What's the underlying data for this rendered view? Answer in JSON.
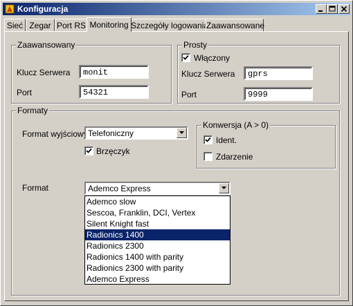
{
  "window": {
    "title": "Konfiguracja"
  },
  "tabs": [
    {
      "label": "Sieć"
    },
    {
      "label": "Zegar"
    },
    {
      "label": "Port RS"
    },
    {
      "label": "Monitoring"
    },
    {
      "label": "Szczegóły logowania"
    },
    {
      "label": "Zaawansowane"
    }
  ],
  "active_tab": "Monitoring",
  "advanced": {
    "title": "Zaawansowany",
    "server_key_label": "Klucz Serwera",
    "server_key_value": "monit",
    "port_label": "Port",
    "port_value": "54321"
  },
  "simple": {
    "title": "Prosty",
    "enabled_label": "Włączony",
    "enabled_checked": true,
    "server_key_label": "Klucz Serwera",
    "server_key_value": "gprs",
    "port_label": "Port",
    "port_value": "9999"
  },
  "formats": {
    "title": "Formaty",
    "output_format_label": "Format wyjściowy",
    "output_format_value": "Telefoniczny",
    "buzzer_label": "Brzęczyk",
    "buzzer_checked": true,
    "conversion": {
      "title": "Konwersja (A > 0)",
      "ident_label": "Ident.",
      "ident_checked": true,
      "event_label": "Zdarzenie",
      "event_checked": false
    },
    "format_label": "Format",
    "format_value": "Ademco Express",
    "format_options": [
      "Ademco slow",
      "Sescoa, Franklin, DCI, Vertex",
      "Silent Knight fast",
      "Radionics 1400",
      "Radionics 2300",
      "Radionics 1400 with parity",
      "Radionics 2300 with parity",
      "Ademco Express"
    ],
    "highlighted_option": "Radionics 1400"
  }
}
